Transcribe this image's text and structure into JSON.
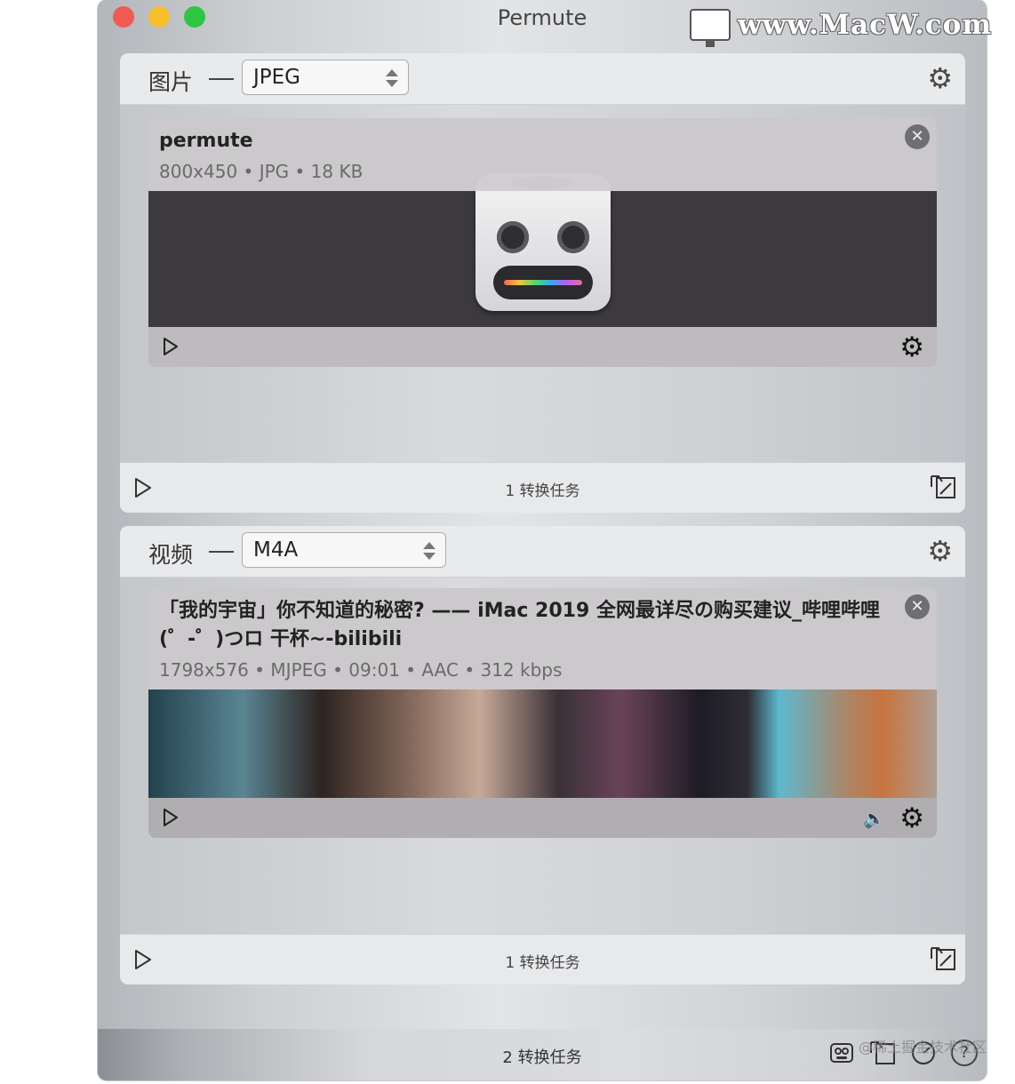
{
  "window": {
    "title": "Permute"
  },
  "watermark": {
    "text": "www.MacW.com"
  },
  "panels": [
    {
      "category": "图片",
      "format": "JPEG",
      "file": {
        "name": "permute",
        "meta": "800x450 • JPG • 18 KB"
      },
      "footer": {
        "tasks": "1 转换任务"
      }
    },
    {
      "category": "视频",
      "format": "M4A",
      "file": {
        "name": "「我的宇宙」你不知道的秘密? —— iMac 2019 全网最详尽の购买建议_哔哩哔哩 (゜-゜)つロ 干杯~-bilibili",
        "meta": "1798x576 • MJPEG • 09:01 • AAC • 312 kbps"
      },
      "footer": {
        "tasks": "1 转换任务"
      }
    }
  ],
  "bottombar": {
    "tasks": "2 转换任务",
    "credit": "@稀土掘金技术社区"
  },
  "icons": {
    "gear": "⚙",
    "close": "✕",
    "speaker": "🔈",
    "help": "?"
  },
  "colors": {
    "close_red": "#ef5b52",
    "minimize_yellow": "#f7be2e",
    "zoom_green": "#2fc540"
  }
}
